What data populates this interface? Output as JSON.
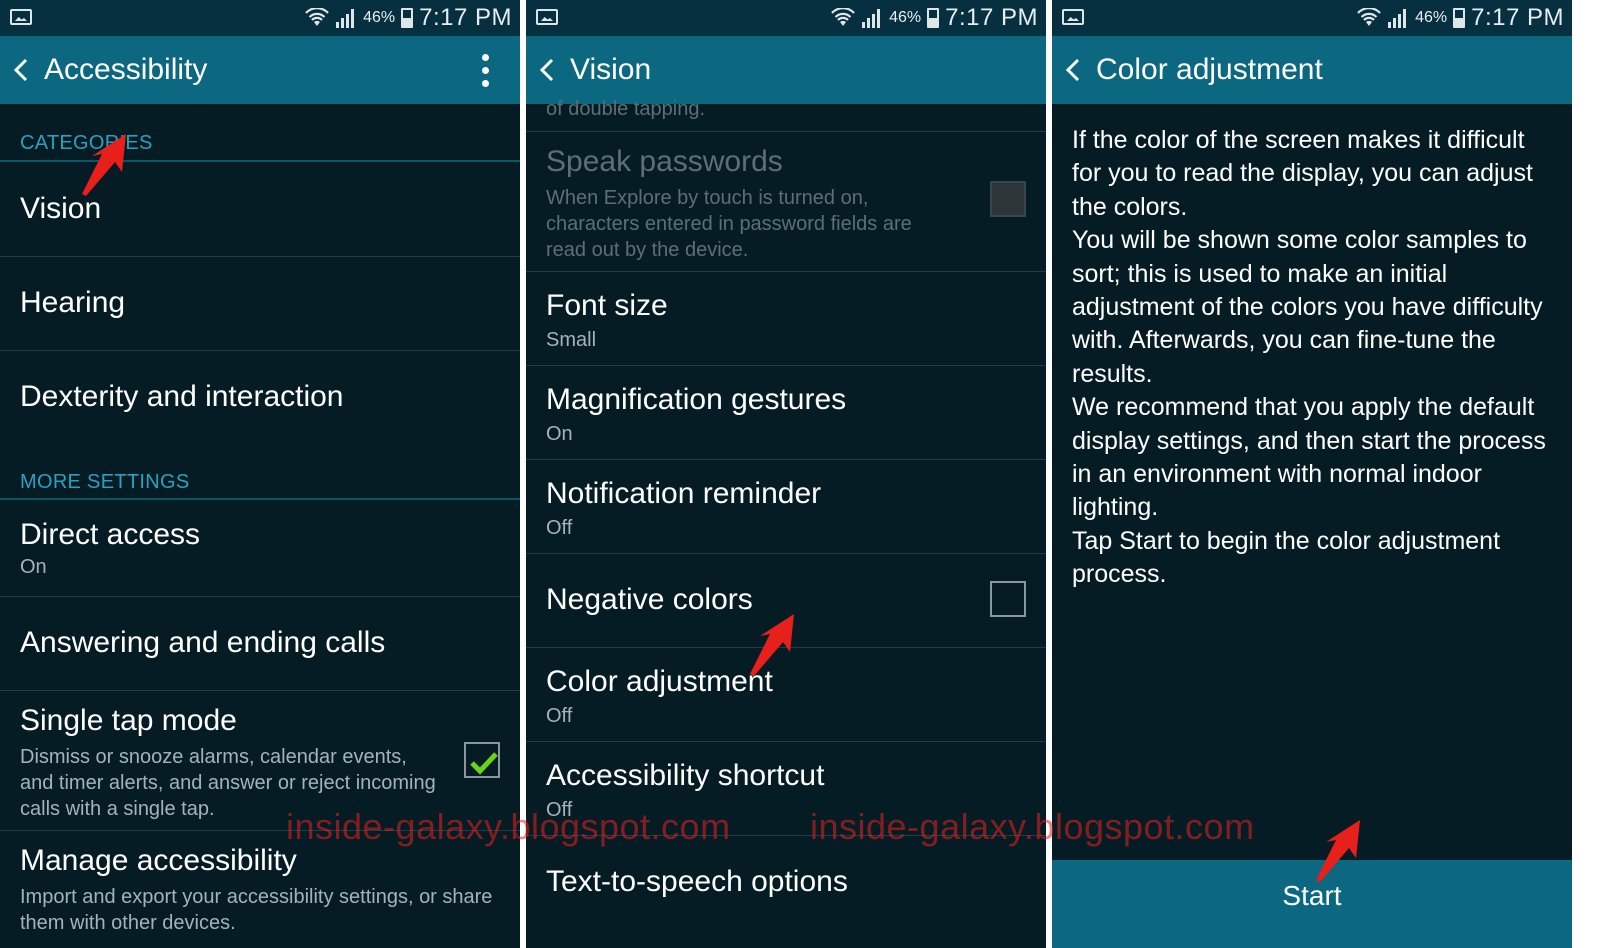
{
  "status_bar": {
    "battery": "46%",
    "time": "7:17 PM"
  },
  "panel1": {
    "title": "Accessibility",
    "category_heading": "CATEGORIES",
    "categories": [
      "Vision",
      "Hearing",
      "Dexterity and interaction"
    ],
    "more_heading": "MORE SETTINGS",
    "direct_access": {
      "title": "Direct access",
      "value": "On"
    },
    "answering": {
      "title": "Answering and ending calls"
    },
    "single_tap": {
      "title": "Single tap mode",
      "desc": "Dismiss or snooze alarms, calendar events, and timer alerts, and answer or reject incoming calls with a single tap.",
      "checked": true
    },
    "manage": {
      "title": "Manage accessibility",
      "desc": "Import and export your accessibility settings, or share them with other devices."
    }
  },
  "panel2": {
    "title": "Vision",
    "partial_text": "of double tapping.",
    "speak_passwords": {
      "title": "Speak passwords",
      "desc": "When Explore by touch is turned on, characters entered in password fields are read out by the device."
    },
    "font_size": {
      "title": "Font size",
      "value": "Small"
    },
    "magnification": {
      "title": "Magnification gestures",
      "value": "On"
    },
    "notification": {
      "title": "Notification reminder",
      "value": "Off"
    },
    "negative": {
      "title": "Negative colors"
    },
    "color_adjustment": {
      "title": "Color adjustment",
      "value": "Off"
    },
    "shortcut": {
      "title": "Accessibility shortcut",
      "value": "Off"
    },
    "tts": {
      "title": "Text-to-speech options"
    }
  },
  "panel3": {
    "title": "Color adjustment",
    "paragraphs": [
      "If the color of the screen makes it difficult for you to read the display, you can adjust the colors.",
      "You will be shown some color samples to sort; this is used to make an initial adjustment of the colors you have difficulty with. Afterwards, you can fine-tune the results.",
      "We recommend that you apply the default display settings, and then start the process in an environment with normal indoor lighting.",
      "Tap Start to begin the color adjustment process."
    ],
    "start": "Start"
  },
  "watermark": "inside-galaxy.blogspot.com",
  "colors": {
    "appbar": "#0b6880",
    "statusbar": "#062f3f",
    "background": "#061c25",
    "accent": "#2aa1bd",
    "check": "#6ad21b",
    "annotation": "#e8201c"
  }
}
